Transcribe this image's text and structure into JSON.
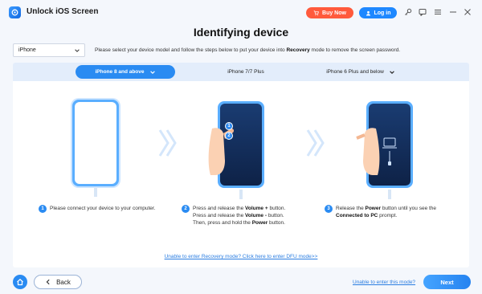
{
  "app": {
    "title": "Unlock iOS Screen"
  },
  "titlebar": {
    "buy_label": "Buy Now",
    "login_label": "Log in",
    "icons": [
      "key-icon",
      "chat-icon",
      "menu-icon",
      "minimize-icon",
      "close-icon"
    ]
  },
  "main": {
    "title": "Identifying device",
    "device_select": {
      "value": "iPhone"
    },
    "instruction_prefix": "Please select your device model and follow the steps below to put your device into ",
    "instruction_bold": "Recovery",
    "instruction_suffix": " mode to remove the screen password."
  },
  "tabs": [
    {
      "label": "iPhone 8 and above",
      "active": true
    },
    {
      "label": "iPhone 7/7 Plus",
      "active": false
    },
    {
      "label": "iPhone 6 Plus and below",
      "active": false
    }
  ],
  "phone_badges": [
    "1",
    "2"
  ],
  "steps": [
    {
      "number": "1",
      "text": "Please connect your device to your computer."
    },
    {
      "number": "2",
      "line1_prefix": "Press and release the ",
      "line1_bold": "Volume +",
      "line1_suffix": " button.",
      "line2_prefix": "Press and release the ",
      "line2_bold": "Volume -",
      "line2_suffix": " button.",
      "line3_prefix": "Then, press and hold the ",
      "line3_bold": "Power",
      "line3_suffix": " button."
    },
    {
      "number": "3",
      "line1_prefix": "Release the ",
      "line1_bold": "Power",
      "line1_suffix": " button until you see the",
      "line2_bold": "Connected to PC",
      "line2_suffix": " prompt."
    }
  ],
  "links": {
    "dfu": "Unable to enter Recovery mode? Click here to enter DFU mode>>",
    "unable": "Unable to enter this mode?"
  },
  "footer": {
    "back_label": "Back",
    "next_label": "Next"
  },
  "colors": {
    "accent": "#2a8bf2",
    "buy": "#ff5a3c",
    "background": "#f4f7fc"
  }
}
